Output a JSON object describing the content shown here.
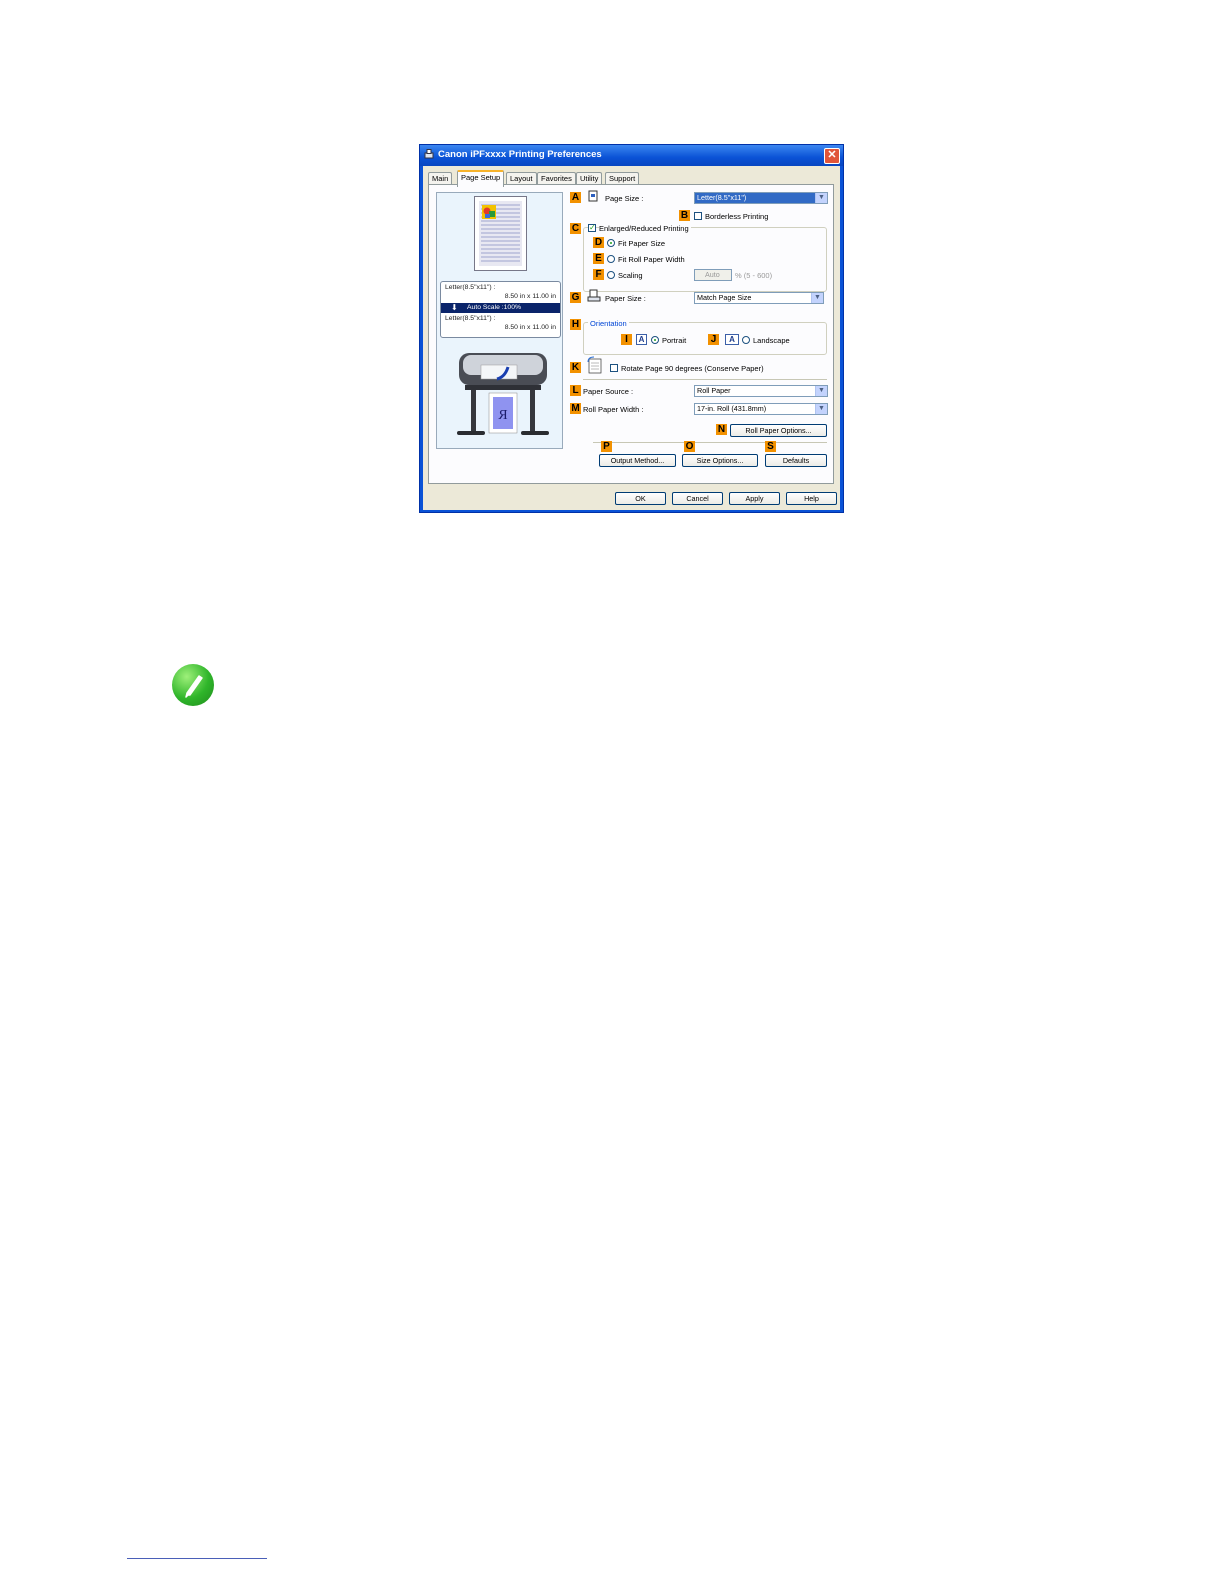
{
  "dialog": {
    "title": "Canon iPFxxxx Printing Preferences",
    "close_glyph": "✕",
    "tabs": [
      "Main",
      "Page Setup",
      "Layout",
      "Favorites",
      "Utility",
      "Support"
    ],
    "active_tab": "Page Setup"
  },
  "preview": {
    "info_line1": "Letter(8.5\"x11\") :",
    "info_line2": "8.50 in x 11.00 in",
    "info_scale": "Auto Scale :100%",
    "info_line3": "Letter(8.5\"x11\") :",
    "info_line4": "8.50 in x 11.00 in",
    "printer_label": "R"
  },
  "settings": {
    "A": {
      "badge": "A",
      "label": "Page Size :",
      "value": "Letter(8.5\"x11\")"
    },
    "B": {
      "badge": "B",
      "label": "Borderless Printing",
      "checked": false
    },
    "C": {
      "badge": "C",
      "label": "Enlarged/Reduced Printing",
      "checked": true
    },
    "D": {
      "badge": "D",
      "label": "Fit Paper Size",
      "selected": true
    },
    "E": {
      "badge": "E",
      "label": "Fit Roll Paper Width",
      "selected": false
    },
    "F": {
      "badge": "F",
      "label": "Scaling",
      "selected": false,
      "scale_value": "Auto",
      "scale_range": "% (5 - 600)"
    },
    "G": {
      "badge": "G",
      "label": "Paper Size :",
      "value": "Match Page Size"
    },
    "H": {
      "badge": "H",
      "label": "Orientation"
    },
    "I": {
      "badge": "I",
      "label": "Portrait",
      "selected": true
    },
    "J": {
      "badge": "J",
      "label": "Landscape",
      "selected": false
    },
    "K": {
      "badge": "K",
      "label": "Rotate Page 90 degrees (Conserve Paper)",
      "checked": false
    },
    "L": {
      "badge": "L",
      "label": "Paper Source :",
      "value": "Roll Paper"
    },
    "M": {
      "badge": "M",
      "label": "Roll Paper Width :",
      "value": "17-in. Roll (431.8mm)"
    },
    "N": {
      "badge": "N",
      "label": "Roll Paper Options..."
    },
    "P": {
      "badge": "P",
      "label": "Output Method..."
    },
    "O": {
      "badge": "O",
      "label": "Size Options..."
    },
    "S": {
      "badge": "S",
      "label": "Defaults"
    }
  },
  "buttons": {
    "ok": "OK",
    "cancel": "Cancel",
    "apply": "Apply",
    "help": "Help"
  },
  "icons": {
    "note": "pencil-note-icon",
    "check_glyph": "✓",
    "arrow_glyph": "▼",
    "down_arrow": "⬇",
    "orient_glyph": "A"
  },
  "colors": {
    "badge": "#f29100",
    "titlebar": "#0a52d6",
    "note": "#2fb52a"
  }
}
